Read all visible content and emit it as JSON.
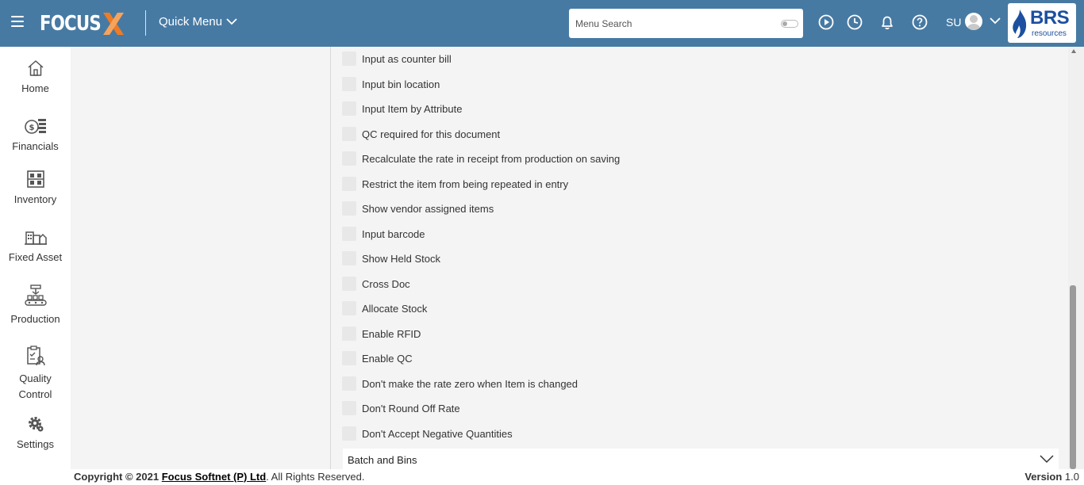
{
  "header": {
    "brand": "FOCUS",
    "quick_menu_label": "Quick Menu",
    "search_placeholder": "Menu Search",
    "user_initials": "SU",
    "partner_brand": "BRS",
    "partner_sub": "resources",
    "icons": [
      "play-icon",
      "clock-icon",
      "bell-icon",
      "help-icon"
    ]
  },
  "sidebar": {
    "items": [
      {
        "label": "Home",
        "icon": "home-icon"
      },
      {
        "label": "Financials",
        "icon": "financials-icon"
      },
      {
        "label": "Inventory",
        "icon": "inventory-icon"
      },
      {
        "label": "Fixed Asset",
        "icon": "fixed-asset-icon"
      },
      {
        "label": "Production",
        "icon": "production-icon"
      },
      {
        "label": "Quality",
        "label2": "Control",
        "icon": "quality-control-icon"
      },
      {
        "label": "Settings",
        "icon": "settings-icon"
      }
    ]
  },
  "options": [
    {
      "label": "Input as counter bill",
      "checked": false
    },
    {
      "label": "Input bin location",
      "checked": false
    },
    {
      "label": "Input Item by Attribute",
      "checked": false
    },
    {
      "label": "QC required for this document",
      "checked": false
    },
    {
      "label": "Recalculate the rate in receipt from production on saving",
      "checked": false
    },
    {
      "label": "Restrict the item from being repeated in entry",
      "checked": false
    },
    {
      "label": "Show vendor assigned items",
      "checked": false
    },
    {
      "label": "Input barcode",
      "checked": false
    },
    {
      "label": "Show Held Stock",
      "checked": false
    },
    {
      "label": "Cross Doc",
      "checked": false
    },
    {
      "label": "Allocate Stock",
      "checked": false
    },
    {
      "label": "Enable RFID",
      "checked": false
    },
    {
      "label": "Enable QC",
      "checked": false
    },
    {
      "label": "Don't make the rate zero when Item is changed",
      "checked": false
    },
    {
      "label": "Don't Round Off Rate",
      "checked": false
    },
    {
      "label": "Don't Accept Negative Quantities",
      "checked": false
    }
  ],
  "section": {
    "title": "Batch and Bins"
  },
  "footer": {
    "copyright_prefix": "Copyright © 2021",
    "company": "Focus Softnet (P) Ltd",
    "suffix": ". All Rights Reserved.",
    "version_label": "Version",
    "version_value": "1.0"
  },
  "colors": {
    "header_bg": "#477aa3",
    "accent_orange": "#ee7c25",
    "partner_blue": "#1c4fa0"
  }
}
